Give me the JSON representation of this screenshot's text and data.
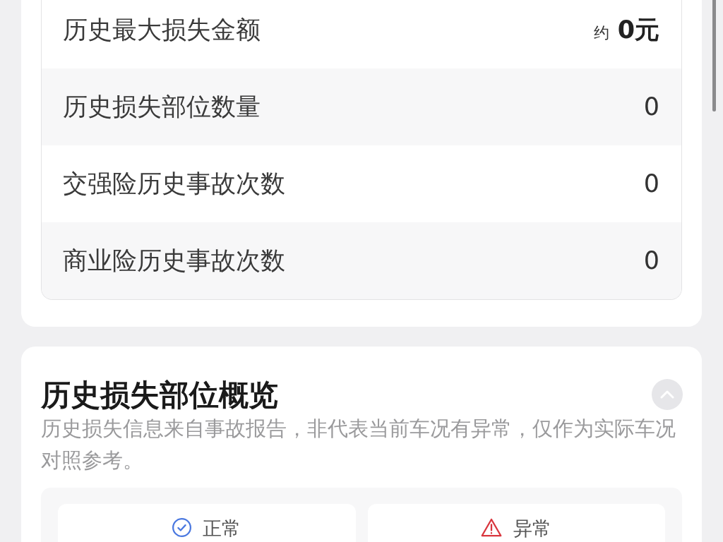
{
  "history_table": {
    "rows": [
      {
        "kind": "amount",
        "label": "历史最大损失金额",
        "prefix": "约",
        "value": "0元"
      },
      {
        "kind": "count",
        "label": "历史损失部位数量",
        "value": "0"
      },
      {
        "kind": "count",
        "label": "交强险历史事故次数",
        "value": "0"
      },
      {
        "kind": "count",
        "label": "商业险历史事故次数",
        "value": "0"
      }
    ]
  },
  "damage_overview": {
    "title": "历史损失部位概览",
    "collapse_button": {
      "expanded": true
    },
    "description": "历史损失信息来自事故报告，非代表当前车况有异常，仅作为实际车况对照参考。",
    "legend": [
      {
        "kind": "normal",
        "label": "正常",
        "color": "#4a78e0"
      },
      {
        "kind": "abnormal",
        "label": "异常",
        "color": "#d9363e"
      }
    ]
  }
}
